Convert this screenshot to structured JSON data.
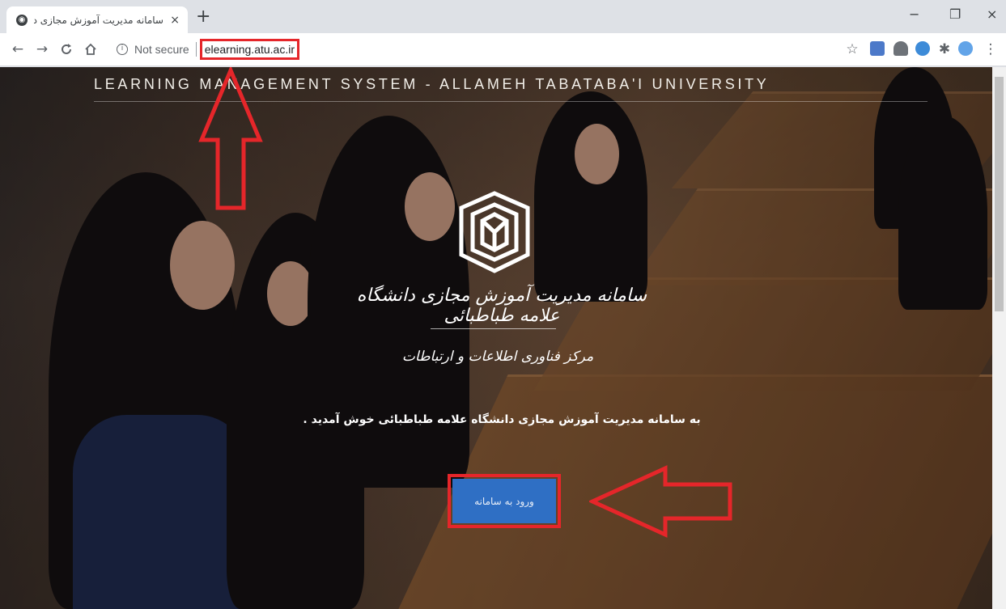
{
  "browser": {
    "tab_title": "سامانه مدیریت آموزش مجازی دانشگاه علامه",
    "tab_close": "×",
    "new_tab": "+",
    "window_minimize": "−",
    "window_restore": "❐",
    "window_close": "×",
    "security_label": "Not secure",
    "url": "elearning.atu.ac.ir"
  },
  "page": {
    "header_title": "LEARNING MANAGEMENT SYSTEM - ALLAMEH TABATABA'I UNIVERSITY",
    "logo_title": "سامانه مدیریت آموزش مجازی دانشگاه علامه طباطبائی",
    "logo_subtitle": "مرکز فناوری اطلاعات و ارتباطات",
    "welcome_text": "به سامانه مدیریت آموزش مجازی دانشگاه علامه طباطبائی خوش آمدید .",
    "login_button": "ورود به سامانه"
  },
  "colors": {
    "annotation_red": "#e5262a",
    "login_blue": "#2f6fc4"
  },
  "icons": [
    "back-icon",
    "forward-icon",
    "reload-icon",
    "home-icon",
    "info-icon",
    "star-icon",
    "puzzle-icon",
    "profile-icon",
    "menu-icon"
  ]
}
